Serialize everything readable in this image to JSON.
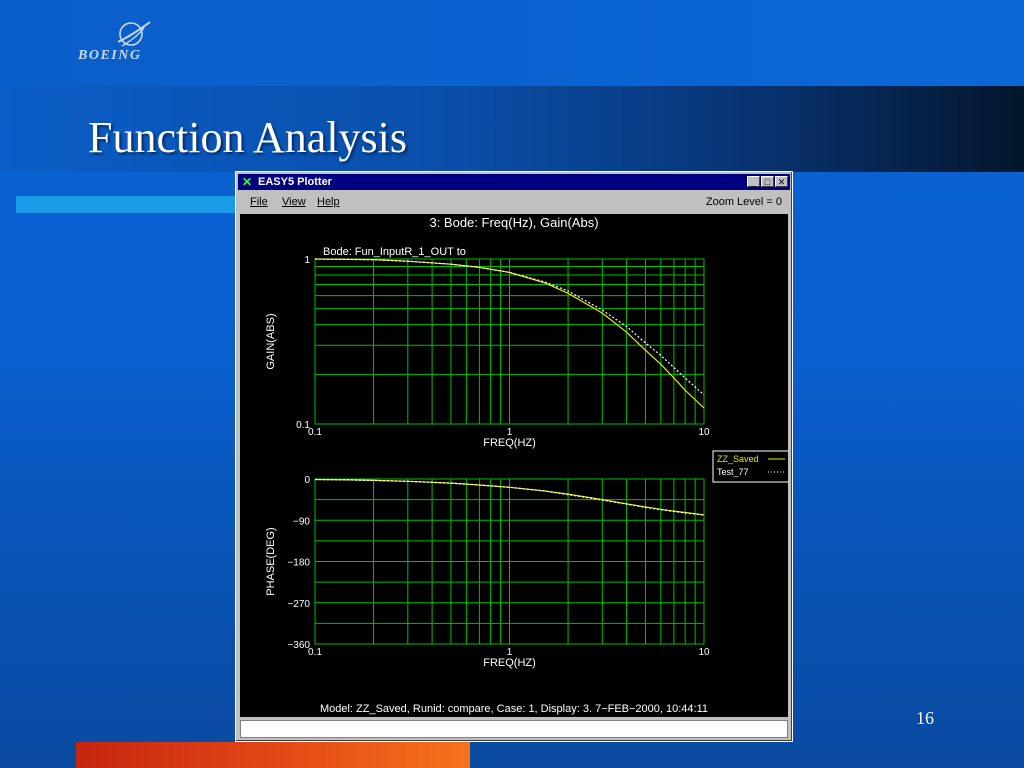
{
  "slide": {
    "brand": "BOEING",
    "title": "Function Analysis",
    "page_number": "16",
    "colors": {
      "background": "#0a5fcf",
      "accent_strip": "#1a9be6",
      "orange_bar": "#e54b16"
    }
  },
  "window": {
    "title": "EASY5 Plotter",
    "icon": "x-icon",
    "controls": {
      "minimize": "_",
      "maximize": "□",
      "close": "✕"
    },
    "menu": [
      "File",
      "View",
      "Help"
    ],
    "zoom_label": "Zoom Level = 0",
    "plot_title": "3: Bode: Freq(Hz), Gain(Abs)",
    "footer": "Model: ZZ_Saved, Runid: compare, Case: 1, Display: 3.  7−FEB−2000, 10:44:11",
    "colors": {
      "grid": "#00c000",
      "series_saved": "#e8e800",
      "series_test": "#ffffff",
      "background": "#000000"
    }
  },
  "chart_data": [
    {
      "type": "line",
      "title": "Bode: Fun_InputR_1_OUT to",
      "xlabel": "FREQ(HZ)",
      "ylabel": "GAIN(ABS)",
      "xscale": "log",
      "yscale": "log",
      "xlim": [
        0.1,
        10
      ],
      "ylim": [
        0.1,
        1
      ],
      "x_ticks": [
        "0.1",
        "1",
        "10"
      ],
      "y_ticks": [
        "1",
        "0.1"
      ],
      "grid": true,
      "legend": "right",
      "x": [
        0.1,
        0.15,
        0.2,
        0.3,
        0.5,
        0.7,
        1,
        1.5,
        2,
        3,
        4,
        5,
        6,
        7,
        8,
        10
      ],
      "series": [
        {
          "name": "ZZ_Saved",
          "values": [
            1.0,
            0.995,
            0.99,
            0.97,
            0.93,
            0.89,
            0.83,
            0.72,
            0.62,
            0.47,
            0.36,
            0.28,
            0.23,
            0.19,
            0.16,
            0.125
          ]
        },
        {
          "name": "Test_77",
          "values": [
            1.0,
            0.995,
            0.99,
            0.97,
            0.93,
            0.89,
            0.83,
            0.73,
            0.64,
            0.49,
            0.39,
            0.31,
            0.26,
            0.22,
            0.19,
            0.15
          ]
        }
      ]
    },
    {
      "type": "line",
      "title": "",
      "xlabel": "FREQ(HZ)",
      "ylabel": "PHASE(DEG)",
      "xscale": "log",
      "xlim": [
        0.1,
        10
      ],
      "ylim": [
        -360,
        0
      ],
      "x_ticks": [
        "0.1",
        "1",
        "10"
      ],
      "y_ticks": [
        "0",
        "−90",
        "−180",
        "−270",
        "−360"
      ],
      "grid": true,
      "legend": "top-right",
      "x": [
        0.1,
        0.15,
        0.2,
        0.3,
        0.5,
        0.7,
        1,
        1.5,
        2,
        3,
        4,
        5,
        6,
        7,
        8,
        10
      ],
      "series": [
        {
          "name": "ZZ_Saved",
          "values": [
            -1,
            -2,
            -3,
            -5,
            -9,
            -13,
            -18,
            -26,
            -33,
            -45,
            -54,
            -61,
            -66,
            -70,
            -73,
            -78
          ]
        },
        {
          "name": "Test_77",
          "values": [
            -1,
            -2,
            -3,
            -5,
            -9,
            -13,
            -18,
            -26,
            -34,
            -46,
            -55,
            -62,
            -67,
            -71,
            -74,
            -79
          ]
        }
      ]
    }
  ]
}
